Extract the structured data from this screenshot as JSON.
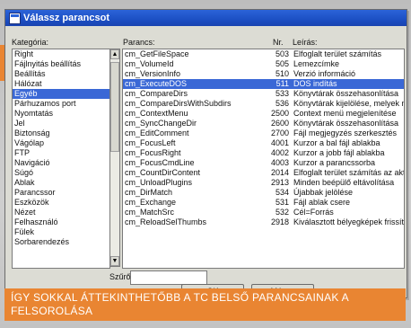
{
  "window": {
    "title": "Válassz parancsot"
  },
  "labels": {
    "category": "Kategória:",
    "command": "Parancs:",
    "nr": "Nr.",
    "description": "Leírás:",
    "filter": "Szűrő:"
  },
  "categories": [
    "Right",
    "Fájlnyitás beállítás",
    "Beállítás",
    "Hálózat",
    "Egyéb",
    "Párhuzamos port",
    "Nyomtatás",
    "Jel",
    "Biztonság",
    "Vágólap",
    "FTP",
    "Navigáció",
    "Súgó",
    "Ablak",
    "Parancssor",
    "Eszközök",
    "Nézet",
    "Felhasználó",
    "Fülek",
    "Sorbarendezés"
  ],
  "selected_category": "Egyéb",
  "commands": [
    {
      "name": "cm_GetFileSpace",
      "nr": "503",
      "desc": "Elfoglalt terület számítás"
    },
    {
      "name": "cm_VolumeId",
      "nr": "505",
      "desc": "Lemezcímke"
    },
    {
      "name": "cm_VersionInfo",
      "nr": "510",
      "desc": "Verzió információ"
    },
    {
      "name": "cm_ExecuteDOS",
      "nr": "511",
      "desc": "DOS indítás"
    },
    {
      "name": "cm_CompareDirs",
      "nr": "533",
      "desc": "Könyvtárak összehasonlítása"
    },
    {
      "name": "cm_CompareDirsWithSubdirs",
      "nr": "536",
      "desc": "Könyvtárak kijelölése, melyek nem szerepelnek"
    },
    {
      "name": "cm_ContextMenu",
      "nr": "2500",
      "desc": "Context menü megjelenítése"
    },
    {
      "name": "cm_SyncChangeDir",
      "nr": "2600",
      "desc": "Könyvtárak összehasonlítása"
    },
    {
      "name": "cm_EditComment",
      "nr": "2700",
      "desc": "Fájl megjegyzés szerkesztés"
    },
    {
      "name": "cm_FocusLeft",
      "nr": "4001",
      "desc": "Kurzor a bal fájl ablakba"
    },
    {
      "name": "cm_FocusRight",
      "nr": "4002",
      "desc": "Kurzor a jobb fájl ablakba"
    },
    {
      "name": "cm_FocusCmdLine",
      "nr": "4003",
      "desc": "Kurzor a parancssorba"
    },
    {
      "name": "cm_CountDirContent",
      "nr": "2014",
      "desc": "Elfoglalt terület számítás az aktuális könyvtárba"
    },
    {
      "name": "cm_UnloadPlugins",
      "nr": "2913",
      "desc": "Minden beépülő eltávolítása"
    },
    {
      "name": "cm_DirMatch",
      "nr": "534",
      "desc": "Újabbak jelölése"
    },
    {
      "name": "cm_Exchange",
      "nr": "531",
      "desc": "Fájl ablak csere"
    },
    {
      "name": "cm_MatchSrc",
      "nr": "532",
      "desc": "Cél=Forrás"
    },
    {
      "name": "cm_ReloadSelThumbs",
      "nr": "2918",
      "desc": "Kiválasztott bélyegképek frissítése"
    }
  ],
  "selected_command": "cm_ExecuteDOS",
  "filter": {
    "value": ""
  },
  "buttons": {
    "ok": "OK",
    "cancel": "Mégse"
  },
  "caption": "ÍGY SOKKAL ÁTTEKINTHETŐBB A TC BELSŐ PARANCSAINAK A FELSOROLÁSA",
  "colors": {
    "selection": "#3a68d6",
    "accent": "#e98532",
    "titlebar": "#2c64d8"
  }
}
